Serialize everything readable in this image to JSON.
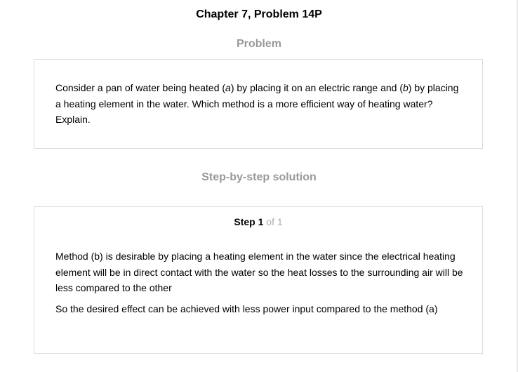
{
  "header": {
    "chapter_title": "Chapter 7, Problem 14P"
  },
  "problem": {
    "heading": "Problem",
    "text_part1": "Consider a pan of water being heated (",
    "marker_a": "a",
    "text_part2": ") by placing it on an electric range and (",
    "marker_b": "b",
    "text_part3": ") by placing a heating element in the water. Which method is a more efficient way of heating water? Explain."
  },
  "solution": {
    "heading": "Step-by-step solution",
    "step": {
      "label": "Step",
      "number": "1",
      "of_text": "of 1"
    },
    "paragraphs": [
      "Method (b) is desirable by placing a heating element in the water since the electrical heating element will be in direct contact with the water so the heat losses to the surrounding air will be less compared to the other",
      "So the desired effect can be achieved with less power input compared to the method (a)"
    ]
  }
}
